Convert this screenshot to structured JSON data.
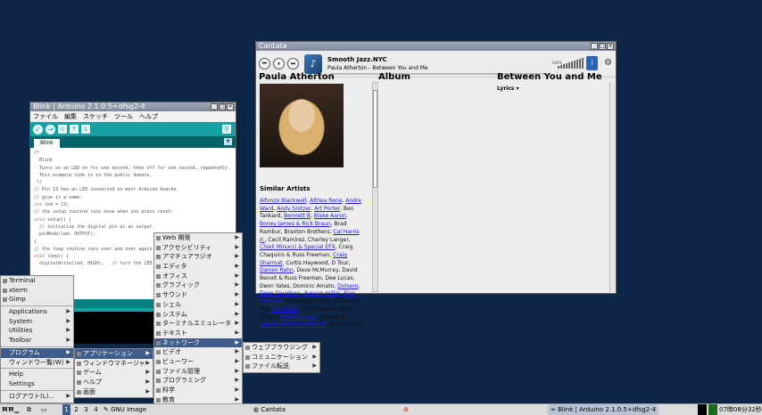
{
  "arduino": {
    "title": "Blink | Arduino 2.1.0.5+dfsg2-4",
    "menus": [
      "ファイル",
      "編集",
      "スケッチ",
      "ツール",
      "ヘルプ"
    ],
    "tab": "Blink",
    "code": [
      "/*",
      "  Blink",
      "  Turns on an LED on for one second, then off for one second, repeatedly.",
      "",
      "  This example code is in the public domain.",
      " */",
      "",
      "// Pin 13 has an LED connected on most Arduino boards.",
      "// give it a name:",
      "int led = 13;",
      "",
      "// the setup routine runs once when you press reset:",
      "void setup() {",
      "  // initialize the digital pin as an output.",
      "  pinMode(led, OUTPUT);",
      "}",
      "",
      "// the loop routine runs over and over again forever:",
      "void loop() {",
      "  digitalWrite(led, HIGH);   // turn the LED on (HIGH is the voltage level)"
    ]
  },
  "cantata": {
    "title": "Cantata",
    "station": "Smooth Jazz.NYC",
    "now_playing": "Paula Atherton - Between You and Me",
    "volume_label": "100%",
    "artist": "Paula Atherton",
    "album_head": "Album",
    "song_head": "Between You and Me",
    "lyrics_label": "Lyrics ▾",
    "similar_heading": "Similar Artists"
  },
  "launcher": {
    "items": [
      {
        "label": "Terminal",
        "sub": false
      },
      {
        "label": "xterm",
        "sub": false
      },
      {
        "label": "Gimp",
        "sub": false
      },
      {
        "label": "Applications",
        "sub": true
      },
      {
        "label": "System",
        "sub": true
      },
      {
        "label": "Utilities",
        "sub": true
      },
      {
        "label": "Toolbar",
        "sub": true
      },
      {
        "label": "プログラム",
        "sub": true
      },
      {
        "label": "ウィンドウ一覧(W)",
        "sub": true
      },
      {
        "label": "Help",
        "sub": false
      },
      {
        "label": "Settings",
        "sub": false
      },
      {
        "label": "ログアウト(L)...",
        "sub": true
      }
    ]
  },
  "menu_programs": [
    "アプリケーション",
    "ウィンドウマネージャ",
    "ゲーム",
    "ヘルプ",
    "画面"
  ],
  "menu_apps": [
    "Web 開発",
    "アクセシビリティ",
    "アマチュアラジオ",
    "エディタ",
    "オフィス",
    "グラフィック",
    "サウンド",
    "シェル",
    "システム",
    "ターミナルエミュレータ",
    "テキスト",
    "ネットワーク",
    "ビデオ",
    "ビューワー",
    "ファイル管理",
    "プログラミング",
    "科学",
    "教育"
  ],
  "menu_network": [
    "ウェブブラウジング",
    "コミュニケーション",
    "ファイル転送"
  ],
  "taskbar": {
    "workspaces": [
      "1",
      "2",
      "3",
      "4"
    ],
    "gnu_image": "GNU Image",
    "cantata": "Cantata",
    "arduino": "Blink | Arduino 2.1.0.5+dfsg2-4",
    "clock": "07時08分32秒"
  },
  "colors": {
    "desktop": "#0d2547",
    "arduino_teal": "#17a1a5",
    "menu_highlight": "#3f5c8a",
    "link": "#1a1ad4"
  }
}
